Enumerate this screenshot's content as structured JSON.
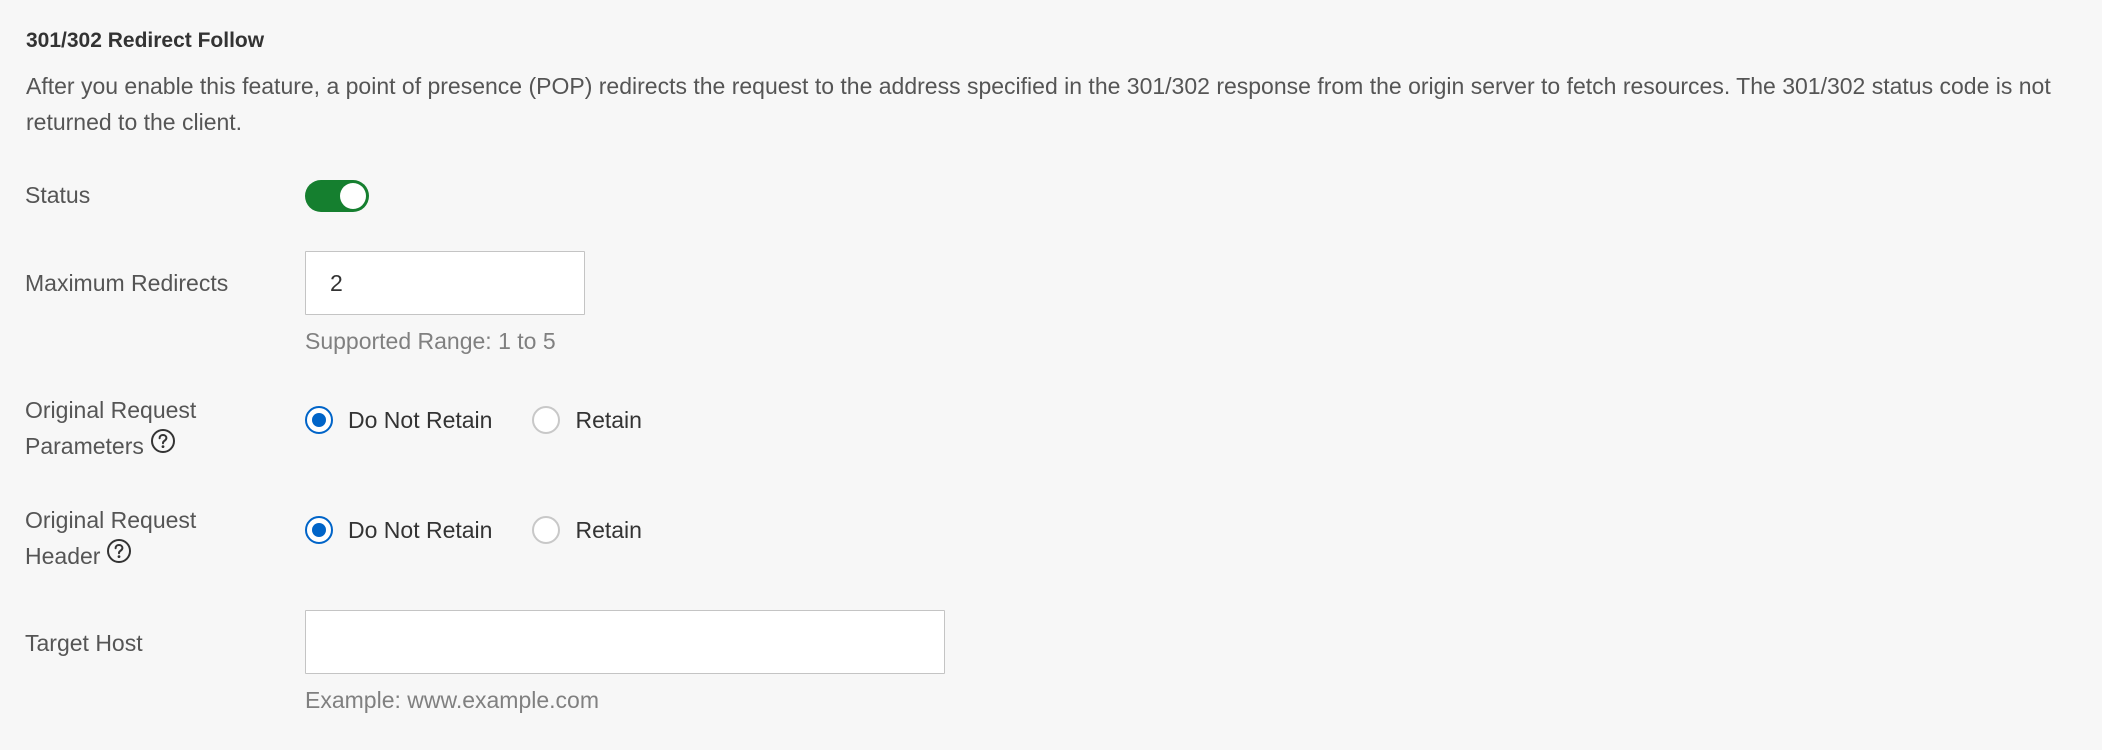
{
  "section": {
    "title": "301/302 Redirect Follow",
    "description": "After you enable this feature, a point of presence (POP) redirects the request to the address specified in the 301/302 response from the origin server to fetch resources. The 301/302 status code is not returned to the client."
  },
  "status": {
    "label": "Status",
    "enabled": true,
    "accent_color": "#157f2f"
  },
  "max_redirects": {
    "label": "Maximum Redirects",
    "value": "2",
    "hint": "Supported Range: 1 to 5"
  },
  "request_params": {
    "label_line1": "Original Request",
    "label_line2": "Parameters",
    "help_icon": "question-circle-icon",
    "options": [
      {
        "label": "Do Not Retain",
        "checked": true
      },
      {
        "label": "Retain",
        "checked": false
      }
    ]
  },
  "request_header": {
    "label_line1": "Original Request",
    "label_line2": "Header",
    "help_icon": "question-circle-icon",
    "options": [
      {
        "label": "Do Not Retain",
        "checked": true
      },
      {
        "label": "Retain",
        "checked": false
      }
    ]
  },
  "target_host": {
    "label": "Target Host",
    "value": "",
    "hint": "Example: www.example.com"
  },
  "colors": {
    "radio_checked": "#0064c8",
    "background": "#f7f7f7"
  }
}
